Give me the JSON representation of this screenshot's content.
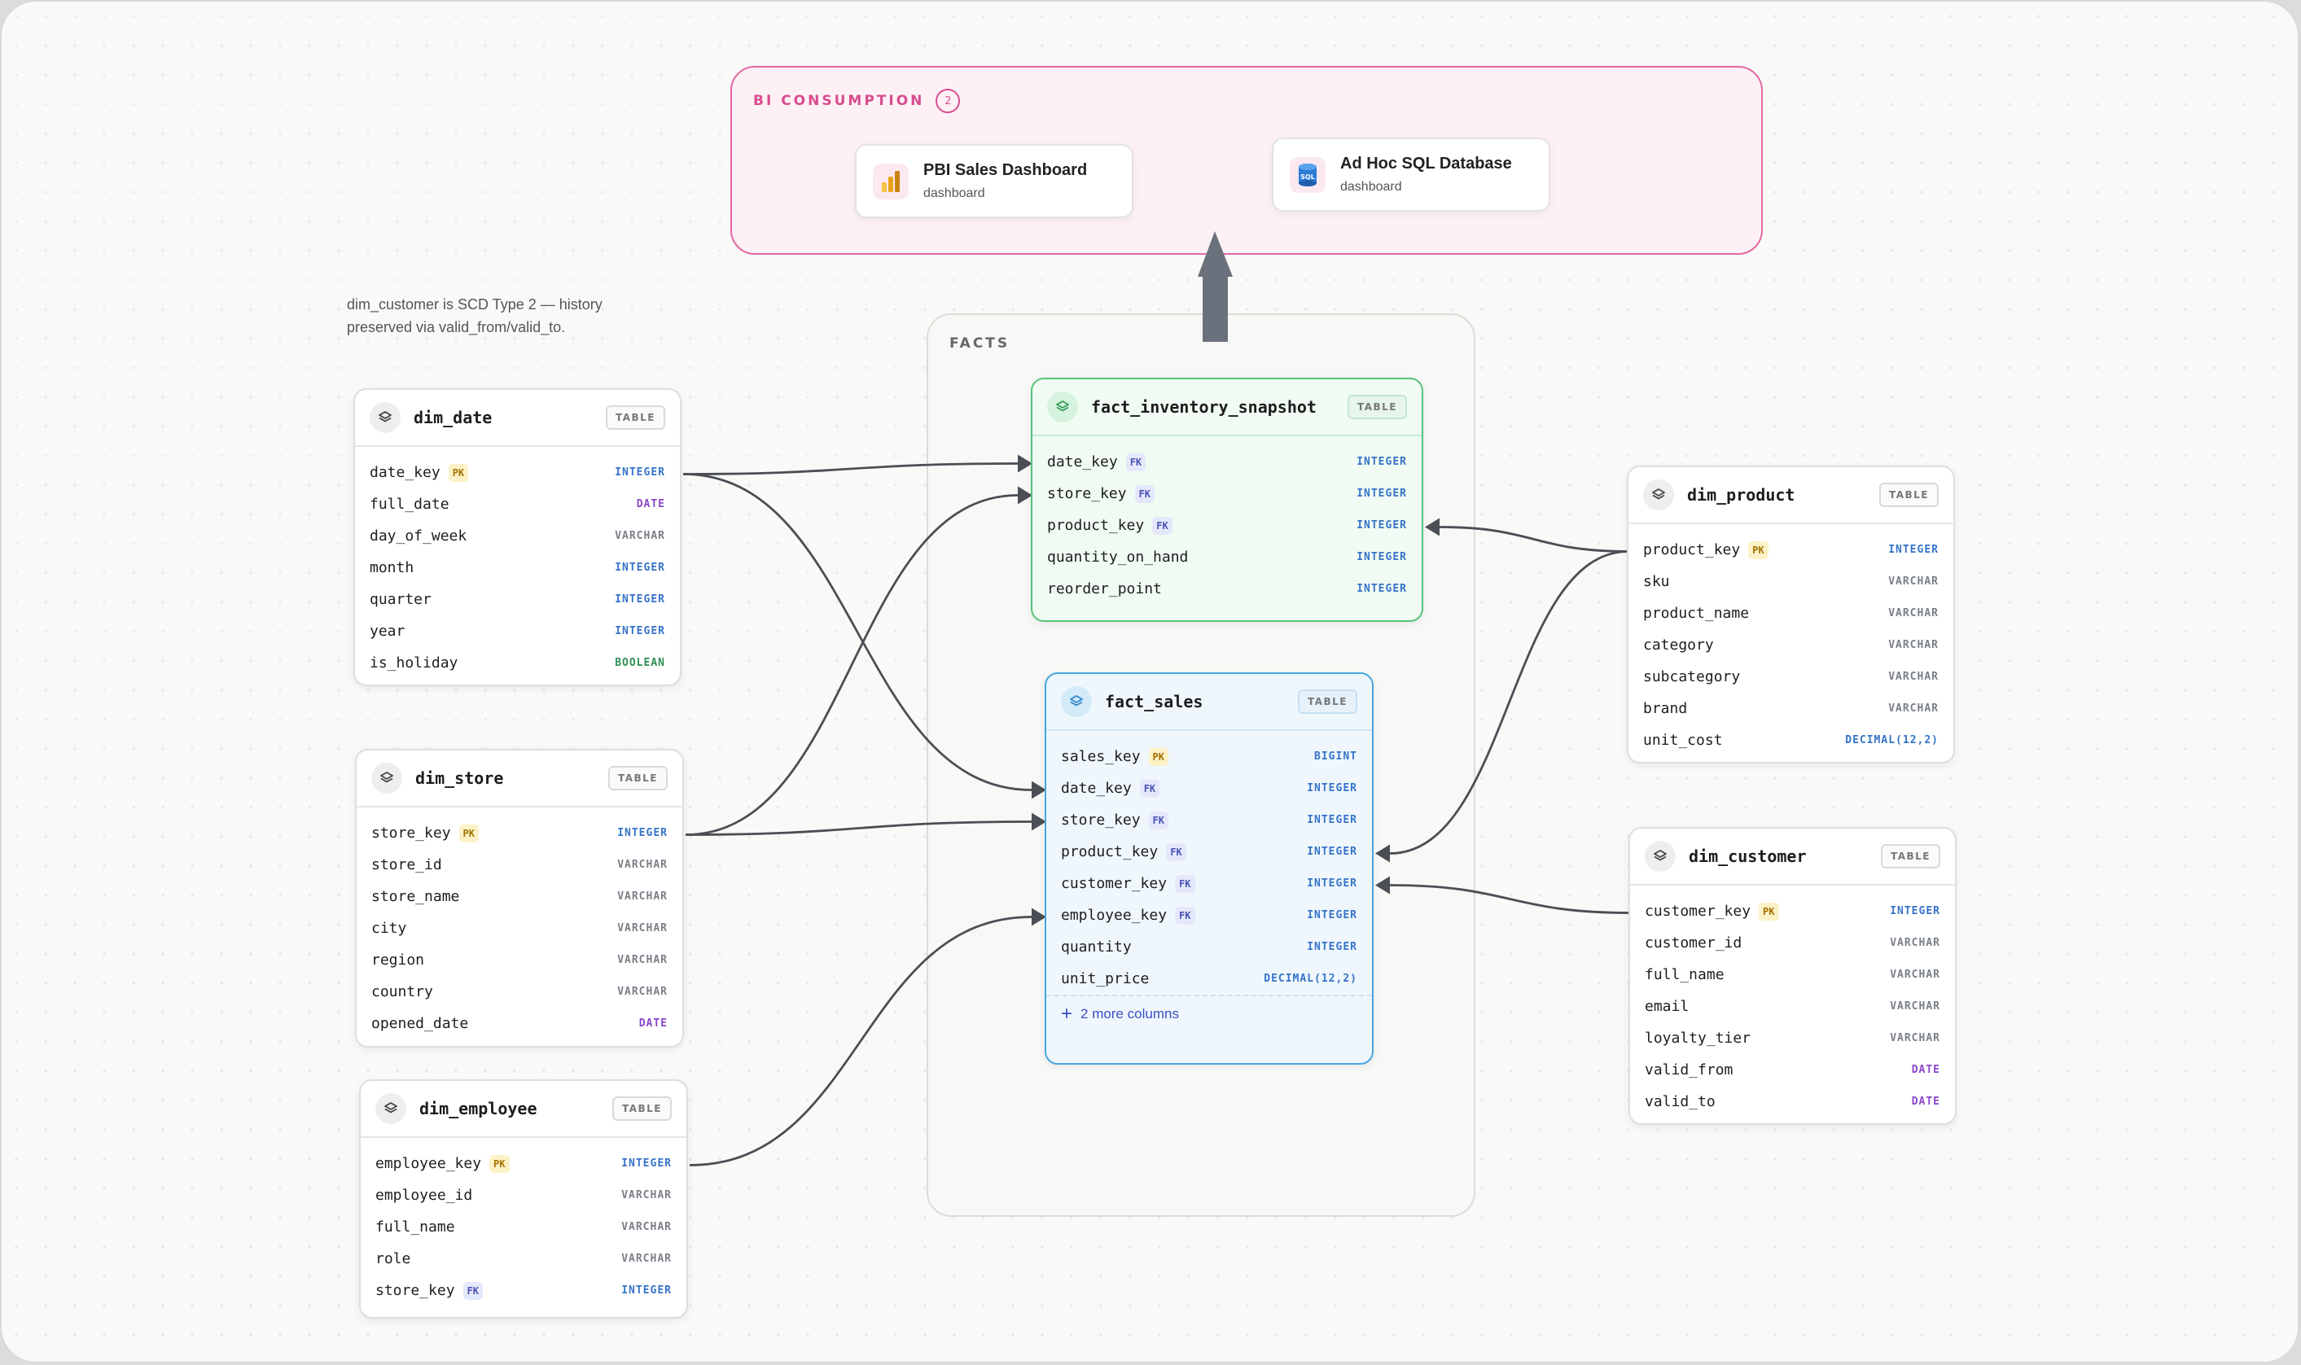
{
  "groups": {
    "bi": {
      "label": "BI CONSUMPTION",
      "count": "2"
    },
    "facts": {
      "label": "FACTS"
    }
  },
  "dashboards": [
    {
      "title": "PBI Sales Dashboard",
      "subtitle": "dashboard",
      "icon": "power-bi-icon"
    },
    {
      "title": "Ad Hoc SQL Database",
      "subtitle": "dashboard",
      "icon": "sql-database-icon"
    }
  ],
  "note": "dim_customer is SCD Type 2 — history preserved via valid_from/valid_to.",
  "badge": "TABLE",
  "tables": {
    "dim_date": {
      "name": "dim_date",
      "columns": [
        {
          "name": "date_key",
          "key": "PK",
          "type": "INTEGER"
        },
        {
          "name": "full_date",
          "key": "",
          "type": "DATE"
        },
        {
          "name": "day_of_week",
          "key": "",
          "type": "VARCHAR"
        },
        {
          "name": "month",
          "key": "",
          "type": "INTEGER"
        },
        {
          "name": "quarter",
          "key": "",
          "type": "INTEGER"
        },
        {
          "name": "year",
          "key": "",
          "type": "INTEGER"
        },
        {
          "name": "is_holiday",
          "key": "",
          "type": "BOOLEAN"
        }
      ]
    },
    "dim_store": {
      "name": "dim_store",
      "columns": [
        {
          "name": "store_key",
          "key": "PK",
          "type": "INTEGER"
        },
        {
          "name": "store_id",
          "key": "",
          "type": "VARCHAR"
        },
        {
          "name": "store_name",
          "key": "",
          "type": "VARCHAR"
        },
        {
          "name": "city",
          "key": "",
          "type": "VARCHAR"
        },
        {
          "name": "region",
          "key": "",
          "type": "VARCHAR"
        },
        {
          "name": "country",
          "key": "",
          "type": "VARCHAR"
        },
        {
          "name": "opened_date",
          "key": "",
          "type": "DATE"
        }
      ]
    },
    "dim_employee": {
      "name": "dim_employee",
      "columns": [
        {
          "name": "employee_key",
          "key": "PK",
          "type": "INTEGER"
        },
        {
          "name": "employee_id",
          "key": "",
          "type": "VARCHAR"
        },
        {
          "name": "full_name",
          "key": "",
          "type": "VARCHAR"
        },
        {
          "name": "role",
          "key": "",
          "type": "VARCHAR"
        },
        {
          "name": "store_key",
          "key": "FK",
          "type": "INTEGER"
        }
      ]
    },
    "fact_inventory_snapshot": {
      "name": "fact_inventory_snapshot",
      "columns": [
        {
          "name": "date_key",
          "key": "FK",
          "type": "INTEGER"
        },
        {
          "name": "store_key",
          "key": "FK",
          "type": "INTEGER"
        },
        {
          "name": "product_key",
          "key": "FK",
          "type": "INTEGER"
        },
        {
          "name": "quantity_on_hand",
          "key": "",
          "type": "INTEGER"
        },
        {
          "name": "reorder_point",
          "key": "",
          "type": "INTEGER"
        }
      ]
    },
    "fact_sales": {
      "name": "fact_sales",
      "more": "2 more columns",
      "columns": [
        {
          "name": "sales_key",
          "key": "PK",
          "type": "BIGINT"
        },
        {
          "name": "date_key",
          "key": "FK",
          "type": "INTEGER"
        },
        {
          "name": "store_key",
          "key": "FK",
          "type": "INTEGER"
        },
        {
          "name": "product_key",
          "key": "FK",
          "type": "INTEGER"
        },
        {
          "name": "customer_key",
          "key": "FK",
          "type": "INTEGER"
        },
        {
          "name": "employee_key",
          "key": "FK",
          "type": "INTEGER"
        },
        {
          "name": "quantity",
          "key": "",
          "type": "INTEGER"
        },
        {
          "name": "unit_price",
          "key": "",
          "type": "DECIMAL(12,2)"
        }
      ]
    },
    "dim_product": {
      "name": "dim_product",
      "columns": [
        {
          "name": "product_key",
          "key": "PK",
          "type": "INTEGER"
        },
        {
          "name": "sku",
          "key": "",
          "type": "VARCHAR"
        },
        {
          "name": "product_name",
          "key": "",
          "type": "VARCHAR"
        },
        {
          "name": "category",
          "key": "",
          "type": "VARCHAR"
        },
        {
          "name": "subcategory",
          "key": "",
          "type": "VARCHAR"
        },
        {
          "name": "brand",
          "key": "",
          "type": "VARCHAR"
        },
        {
          "name": "unit_cost",
          "key": "",
          "type": "DECIMAL(12,2)"
        }
      ]
    },
    "dim_customer": {
      "name": "dim_customer",
      "columns": [
        {
          "name": "customer_key",
          "key": "PK",
          "type": "INTEGER"
        },
        {
          "name": "customer_id",
          "key": "",
          "type": "VARCHAR"
        },
        {
          "name": "full_name",
          "key": "",
          "type": "VARCHAR"
        },
        {
          "name": "email",
          "key": "",
          "type": "VARCHAR"
        },
        {
          "name": "loyalty_tier",
          "key": "",
          "type": "VARCHAR"
        },
        {
          "name": "valid_from",
          "key": "",
          "type": "DATE"
        },
        {
          "name": "valid_to",
          "key": "",
          "type": "DATE"
        }
      ]
    }
  },
  "relationships": [
    {
      "from": "dim_date.date_key",
      "to": "fact_inventory_snapshot.date_key"
    },
    {
      "from": "dim_date.date_key",
      "to": "fact_sales.date_key"
    },
    {
      "from": "dim_store.store_key",
      "to": "fact_inventory_snapshot.store_key"
    },
    {
      "from": "dim_store.store_key",
      "to": "fact_sales.store_key"
    },
    {
      "from": "dim_employee.employee_key",
      "to": "fact_sales.employee_key"
    },
    {
      "from": "dim_product.product_key",
      "to": "fact_inventory_snapshot.product_key"
    },
    {
      "from": "dim_product.product_key",
      "to": "fact_sales.product_key"
    },
    {
      "from": "dim_customer.customer_key",
      "to": "fact_sales.customer_key"
    },
    {
      "from": "facts",
      "to": "bi_consumption"
    }
  ]
}
